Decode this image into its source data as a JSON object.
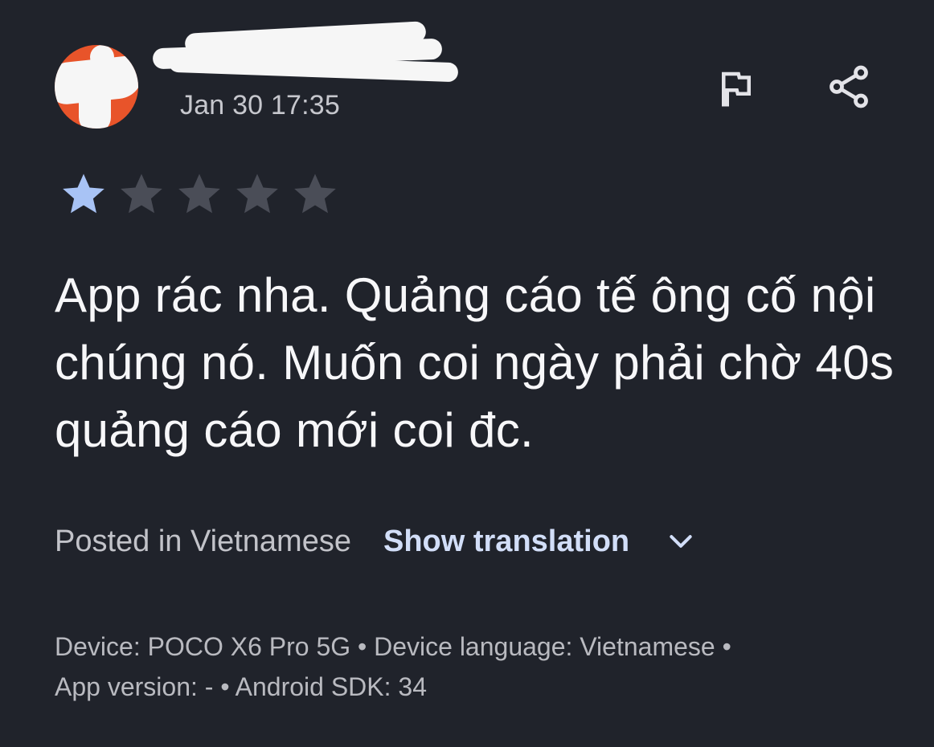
{
  "review": {
    "timestamp": "Jan 30 17:35",
    "rating": 1,
    "rating_max": 5,
    "text": "App rác nha. Quảng cáo tế ông cố nội chúng nó. Muốn coi ngày phải chờ 40s quảng cáo mới coi đc.",
    "posted_in": "Posted in Vietnamese",
    "show_translation": "Show translation",
    "device_info_line1": "Device: POCO X6 Pro 5G • Device language: Vietnamese •",
    "device_info_line2": "App version: - • Android SDK: 34"
  },
  "icons": {
    "flag": "flag-icon",
    "share": "share-icon",
    "chevron": "chevron-down-icon",
    "star": "star-icon"
  },
  "colors": {
    "background": "#20232b",
    "avatar": "#e8542a",
    "star_filled": "#a8c3f5",
    "star_empty": "#4a4d57",
    "link": "#d2def8"
  }
}
